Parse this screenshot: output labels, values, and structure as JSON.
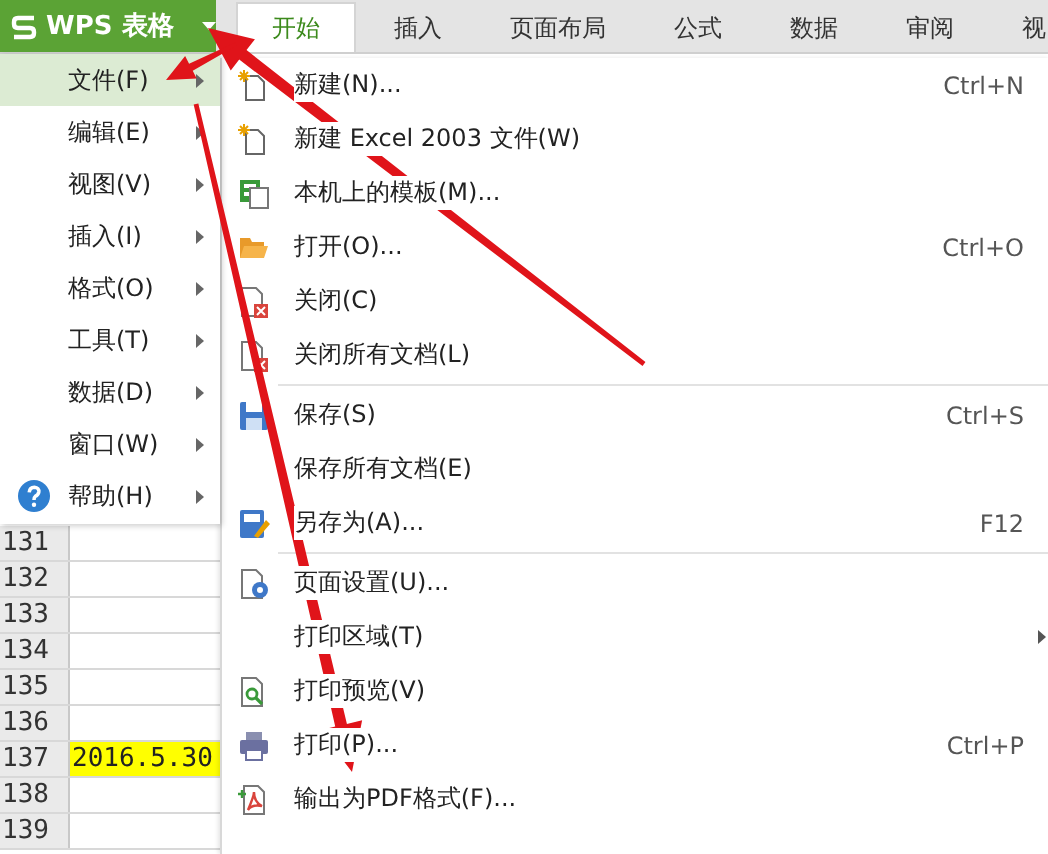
{
  "app_button": {
    "label": "WPS 表格"
  },
  "ribbon_tabs": [
    {
      "label": "开始",
      "selected": true
    },
    {
      "label": "插入",
      "selected": false
    },
    {
      "label": "页面布局",
      "selected": false
    },
    {
      "label": "公式",
      "selected": false
    },
    {
      "label": "数据",
      "selected": false
    },
    {
      "label": "审阅",
      "selected": false
    },
    {
      "label": "视",
      "selected": false
    }
  ],
  "sheet": {
    "rows": [
      {
        "number": "131",
        "highlighted": false
      },
      {
        "number": "132",
        "highlighted": false
      },
      {
        "number": "133",
        "highlighted": false
      },
      {
        "number": "134",
        "highlighted": false
      },
      {
        "number": "135",
        "highlighted": false
      },
      {
        "number": "136",
        "highlighted": false
      },
      {
        "number": "137",
        "cell": "2016.5.30",
        "highlighted": true
      },
      {
        "number": "138",
        "highlighted": false
      },
      {
        "number": "139",
        "highlighted": false
      }
    ]
  },
  "app_menu": {
    "items": [
      {
        "label": "文件(F)",
        "selected": true,
        "kind": "plain"
      },
      {
        "label": "编辑(E)",
        "selected": false,
        "kind": "plain"
      },
      {
        "label": "视图(V)",
        "selected": false,
        "kind": "plain"
      },
      {
        "label": "插入(I)",
        "selected": false,
        "kind": "plain"
      },
      {
        "label": "格式(O)",
        "selected": false,
        "kind": "plain"
      },
      {
        "label": "工具(T)",
        "selected": false,
        "kind": "plain"
      },
      {
        "label": "数据(D)",
        "selected": false,
        "kind": "plain"
      },
      {
        "label": "窗口(W)",
        "selected": false,
        "kind": "plain"
      },
      {
        "label": "帮助(H)",
        "selected": false,
        "kind": "help"
      }
    ]
  },
  "file_menu": {
    "groups": [
      [
        {
          "label": "新建(N)...",
          "shortcut": "Ctrl+N",
          "kind": "new"
        },
        {
          "label": "新建 Excel 2003 文件(W)",
          "kind": "new"
        },
        {
          "label": "本机上的模板(M)...",
          "kind": "template"
        },
        {
          "label": "打开(O)...",
          "shortcut": "Ctrl+O",
          "kind": "open"
        },
        {
          "label": "关闭(C)",
          "kind": "close"
        },
        {
          "label": "关闭所有文档(L)",
          "kind": "close"
        }
      ],
      [
        {
          "label": "保存(S)",
          "shortcut": "Ctrl+S",
          "kind": "save"
        },
        {
          "label": "保存所有文档(E)",
          "kind": "plain"
        },
        {
          "label": "另存为(A)...",
          "shortcut": "F12",
          "kind": "save-as"
        }
      ],
      [
        {
          "label": "页面设置(U)...",
          "kind": "page-setup"
        },
        {
          "label": "打印区域(T)",
          "kind": "plain",
          "submenu": true
        },
        {
          "label": "打印预览(V)",
          "kind": "preview"
        },
        {
          "label": "打印(P)...",
          "shortcut": "Ctrl+P",
          "kind": "print"
        },
        {
          "label": "输出为PDF格式(F)...",
          "kind": "pdf"
        }
      ]
    ]
  }
}
